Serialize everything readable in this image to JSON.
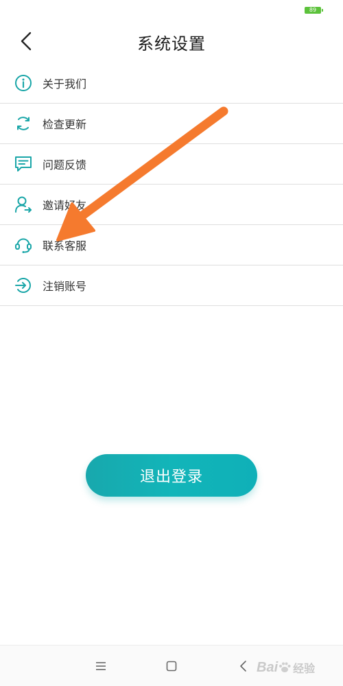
{
  "status_bar": {
    "battery_level": "89",
    "battery_color": "#5cc23b"
  },
  "header": {
    "title": "系统设置",
    "back_icon": "chevron-left-icon"
  },
  "menu": {
    "accent_color": "#1aa6a8",
    "items": [
      {
        "label": "关于我们",
        "icon": "info-icon"
      },
      {
        "label": "检查更新",
        "icon": "refresh-icon"
      },
      {
        "label": "问题反馈",
        "icon": "feedback-icon"
      },
      {
        "label": "邀请好友",
        "icon": "invite-user-icon"
      },
      {
        "label": "联系客服",
        "icon": "headset-icon"
      },
      {
        "label": "注销账号",
        "icon": "sign-out-icon"
      }
    ]
  },
  "logout": {
    "label": "退出登录",
    "color": "#14b1b6"
  },
  "annotation": {
    "type": "arrow",
    "color": "#f57a2e",
    "points_to": "联系客服"
  },
  "nav_bar": {
    "buttons": [
      "menu-icon",
      "home-square-icon",
      "back-icon"
    ]
  },
  "watermark": {
    "brand": "Bai",
    "suffix": "经验"
  }
}
